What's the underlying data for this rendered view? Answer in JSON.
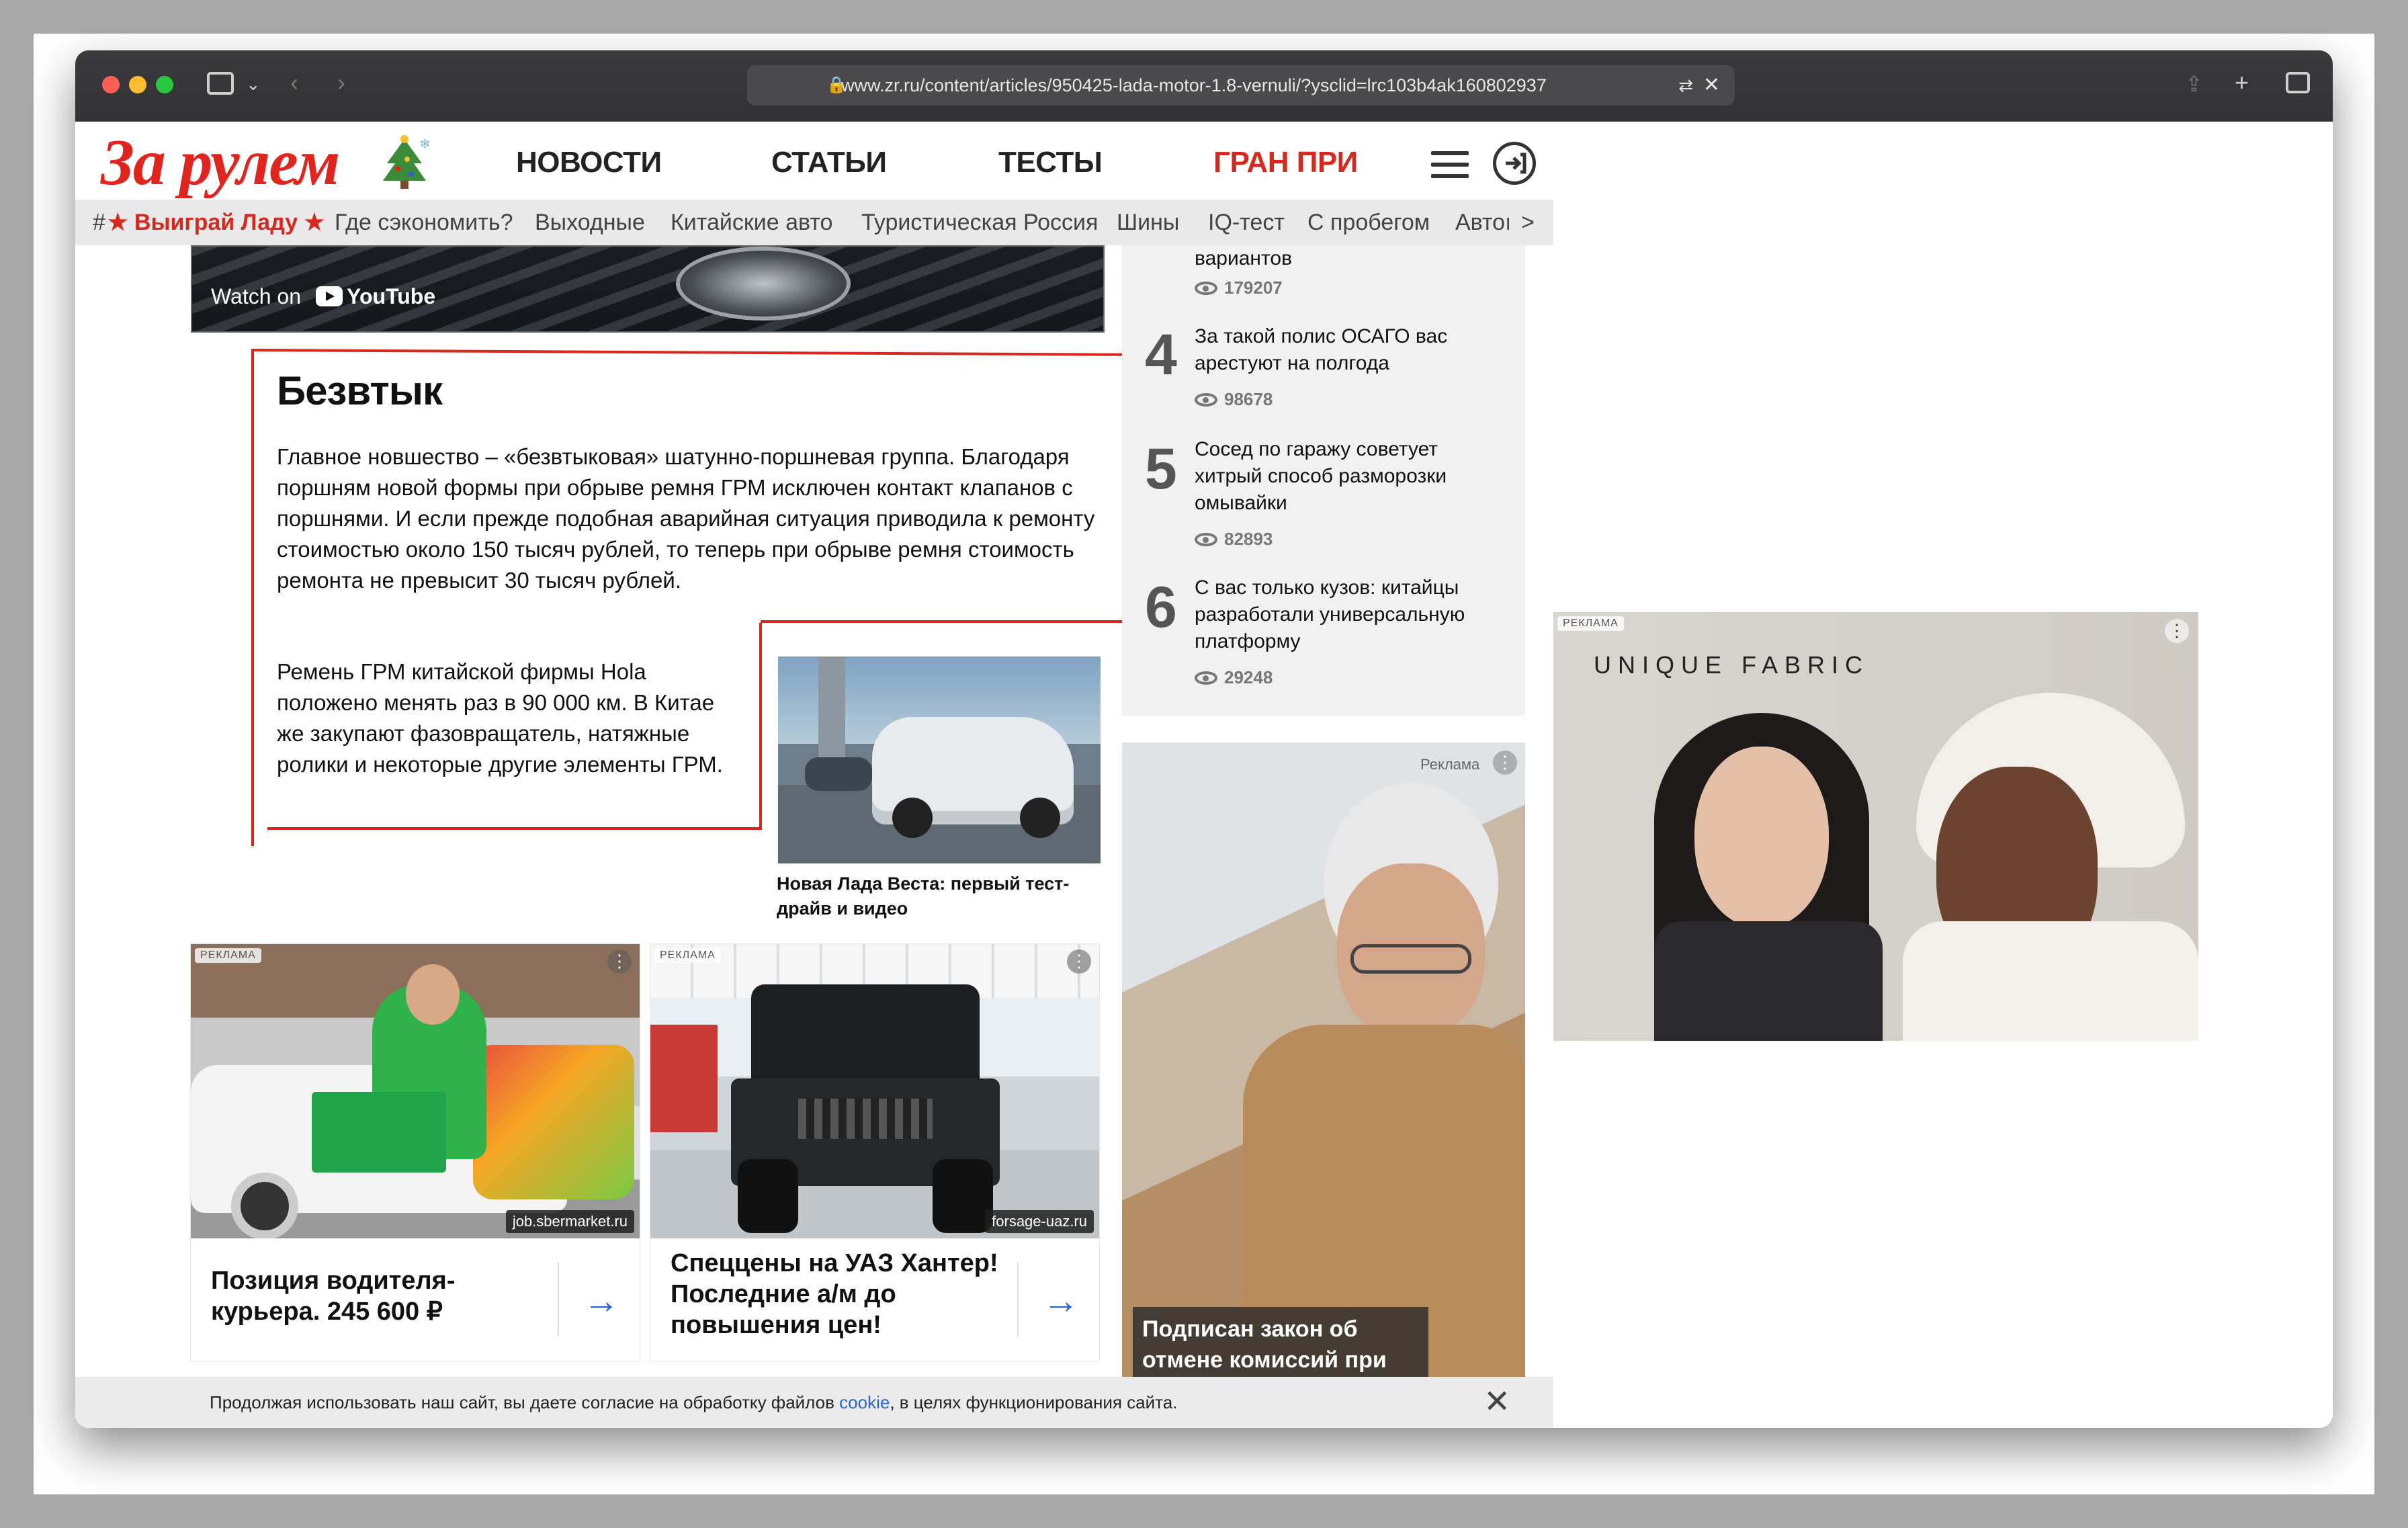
{
  "browser": {
    "url": "www.zr.ru/content/articles/950425-lada-motor-1.8-vernuli/?ysclid=lrc103b4ak160802937"
  },
  "header": {
    "logo": "За рулем",
    "nav": [
      "НОВОСТИ",
      "СТАТЬИ",
      "ТЕСТЫ",
      "ГРАН ПРИ"
    ]
  },
  "subnav": {
    "hash": "#",
    "hot": "★ Выиграй Ладу ★",
    "items": [
      "Где сэкономить?",
      "Выходные",
      "Китайские авто",
      "Туристическая Россия",
      "Шины",
      "IQ-тест",
      "С пробегом",
      "Автоı"
    ],
    "more": ">"
  },
  "video": {
    "watch_on": "Watch on",
    "youtube": "YouTube"
  },
  "article": {
    "heading": "Безвтык",
    "p1": "Главное новшество – «безвтыковая» шатунно-поршневая группа. Благодаря поршням новой формы при обрыве ремня ГРМ исключен контакт клапанов с поршнями. И если прежде подобная аварийная ситуация приводила к ремонту стоимостью около 150 тысяч рублей, то теперь при обрыве ремня стоимость ремонта не превысит 30 тысяч рублей.",
    "p2": "Ремень ГРМ китайской фирмы Hola положено менять раз в 90 000 км. В Китае же закупают фазовращатель, натяжные ролики и некоторые другие элементы ГРМ.",
    "related_caption": "Новая Лада Веста: первый тест-драйв и видео"
  },
  "ads": {
    "label": "РЕКЛАМА",
    "card1": {
      "source": "job.sbermarket.ru",
      "title": "Позиция водителя-курьера. 245 600 ₽"
    },
    "card2": {
      "source": "forsage-uaz.ru",
      "title": "Спеццены на УАЗ Хантер! Последние а/м до повышения цен!"
    },
    "side_label": "Реклама",
    "side_caption": "Подписан закон об отмене комиссий при",
    "right_brand": "UNIQUE FABRIC"
  },
  "popular": {
    "top_text": "вариантов",
    "top_views": "179207",
    "items": [
      {
        "num": "4",
        "text": "За такой полис ОСАГО вас арестуют на полгода",
        "views": "98678"
      },
      {
        "num": "5",
        "text": "Сосед по гаражу советует хитрый способ разморозки омывайки",
        "views": "82893"
      },
      {
        "num": "6",
        "text": "С вас только кузов: китайцы разработали универсальную платформу",
        "views": "29248"
      }
    ]
  },
  "cookie": {
    "before": "Продолжая использовать наш сайт, вы даете согласие на обработку файлов ",
    "link": "cookie",
    "after": ", в целях функционирования сайта."
  }
}
